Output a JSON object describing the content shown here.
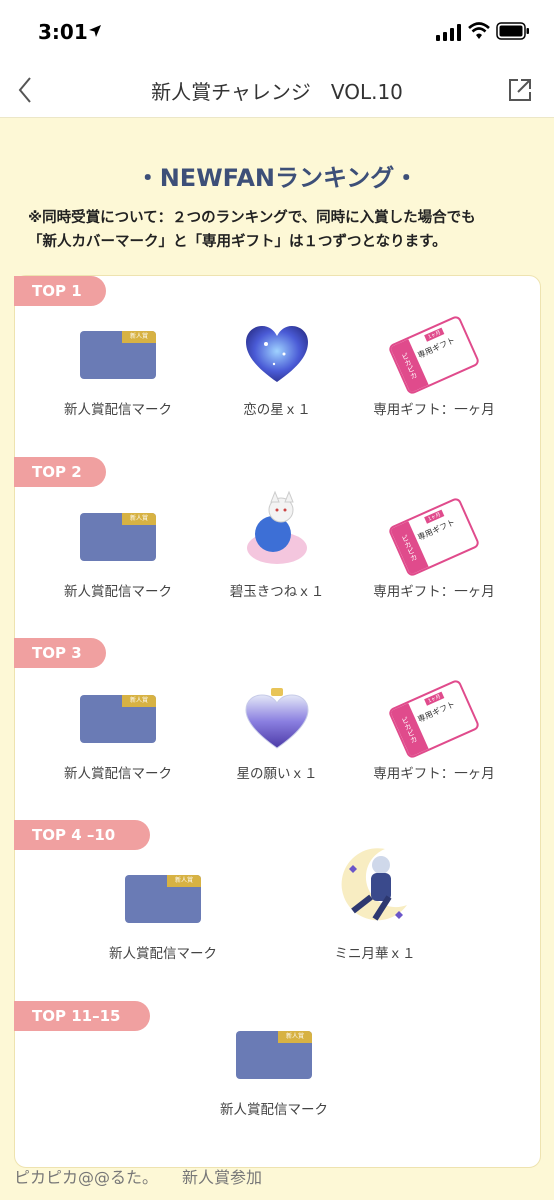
{
  "status": {
    "time": "3:01"
  },
  "nav": {
    "title": "新人賞チャレンジ　VOL.10"
  },
  "section": {
    "title": "NEWFANランキング",
    "notice_line1": "※同時受賞について：２つのランキングで、同時に入賞した場合でも",
    "notice_line2": "「新人カバーマーク」と「専用ギフト」は１つずつとなります。"
  },
  "mark_badge": "新人賞",
  "ticket": {
    "stub": "ピカピカ",
    "text": "専用ギフト",
    "tab": "1ヶ月"
  },
  "tiers": [
    {
      "tag": "TOP 1",
      "prizes": [
        "新人賞配信マーク",
        "恋の星ｘ１",
        "専用ギフト：一ヶ月"
      ]
    },
    {
      "tag": "TOP 2",
      "prizes": [
        "新人賞配信マーク",
        "碧玉きつねｘ１",
        "専用ギフト：一ヶ月"
      ]
    },
    {
      "tag": "TOP 3",
      "prizes": [
        "新人賞配信マーク",
        "星の願いｘ１",
        "専用ギフト：一ヶ月"
      ]
    },
    {
      "tag": "TOP 4 –10",
      "prizes": [
        "新人賞配信マーク",
        "ミニ月華ｘ１"
      ]
    },
    {
      "tag": "TOP 11–15",
      "prizes": [
        "新人賞配信マーク"
      ]
    }
  ],
  "footer": "ピカピカ@@るた。　　新人賞参加"
}
